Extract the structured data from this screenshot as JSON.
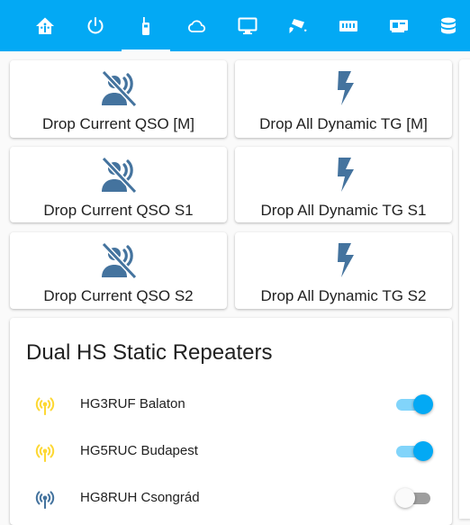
{
  "colors": {
    "toolbar": "#03a9f4",
    "icon_blue": "#44739e",
    "icon_active_yellow": "#fdd835",
    "toggle_on": "#03a9f4",
    "toggle_off": "#9e9e9e"
  },
  "tabs": [
    {
      "icon": "home-assistant-icon",
      "active": false
    },
    {
      "icon": "power-icon",
      "active": false
    },
    {
      "icon": "radio-handheld-icon",
      "active": true
    },
    {
      "icon": "cloud-outline-icon",
      "active": false
    },
    {
      "icon": "monitor-icon",
      "active": false
    },
    {
      "icon": "cctv-icon",
      "active": false
    },
    {
      "icon": "memory-module-icon",
      "active": false
    },
    {
      "icon": "expansion-card-icon",
      "active": false
    },
    {
      "icon": "database-icon",
      "active": false
    }
  ],
  "buttons": [
    {
      "label": "Drop Current QSO [M]",
      "icon": "voice-off-icon"
    },
    {
      "label": "Drop All Dynamic TG [M]",
      "icon": "flash-icon"
    },
    {
      "label": "Drop Current QSO S1",
      "icon": "voice-off-icon"
    },
    {
      "label": "Drop All Dynamic TG S1",
      "icon": "flash-icon"
    },
    {
      "label": "Drop Current QSO S2",
      "icon": "voice-off-icon"
    },
    {
      "label": "Drop All Dynamic TG S2",
      "icon": "flash-icon"
    }
  ],
  "repeaters": {
    "title": "Dual HS Static Repeaters",
    "items": [
      {
        "label": "HG3RUF Balaton",
        "icon": "access-point-icon",
        "on": true
      },
      {
        "label": "HG5RUC Budapest",
        "icon": "access-point-icon",
        "on": true
      },
      {
        "label": "HG8RUH Csongrád",
        "icon": "access-point-icon",
        "on": false
      }
    ]
  }
}
